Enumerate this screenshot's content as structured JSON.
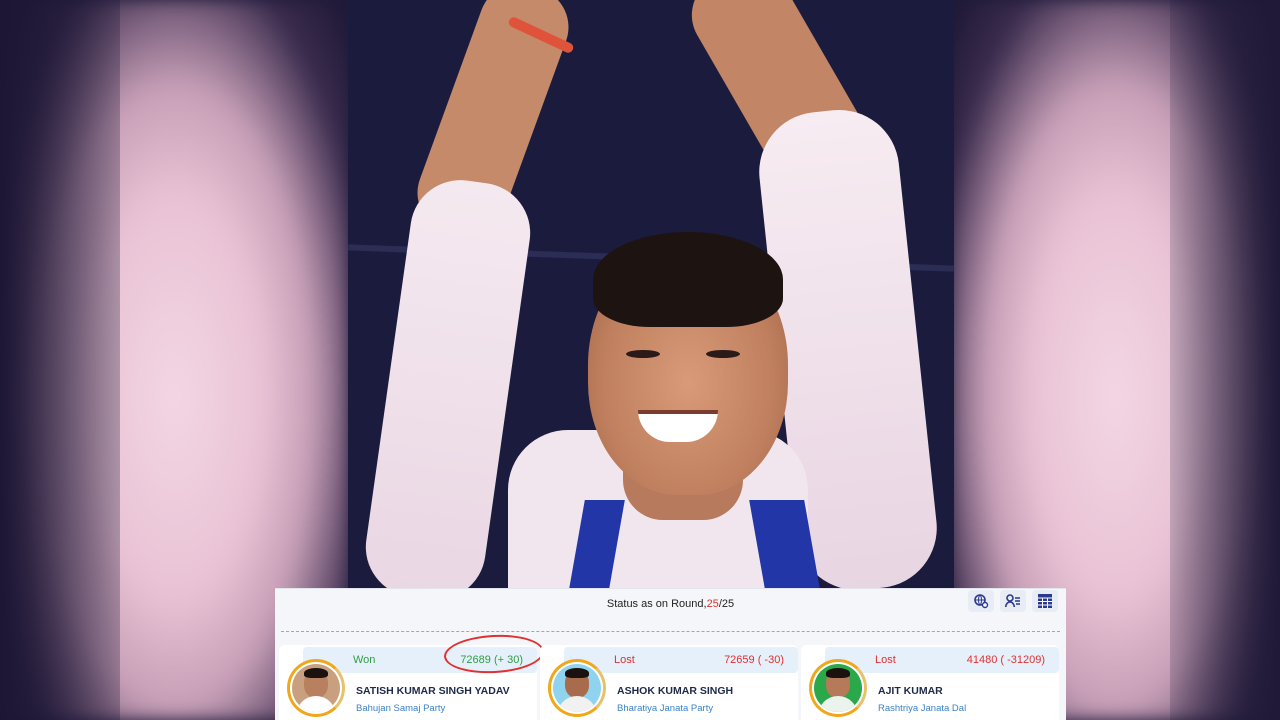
{
  "status": {
    "prefix": "Status as on Round, ",
    "current_round": "25",
    "separator": "/",
    "total_rounds": "25"
  },
  "toolbar": {
    "icons": [
      "globe-search-icon",
      "user-list-icon",
      "table-grid-icon"
    ]
  },
  "candidates": [
    {
      "result": "Won",
      "votes": "72689 (+ 30)",
      "name": "SATISH KUMAR SINGH YADAV",
      "party": "Bahujan Samaj Party",
      "avatar_bg": "#c9a07f"
    },
    {
      "result": "Lost",
      "votes": "72659 ( -30)",
      "name": "ASHOK KUMAR SINGH",
      "party": "Bharatiya Janata Party",
      "avatar_bg": "#8fd3ef"
    },
    {
      "result": "Lost",
      "votes": "41480 ( -31209)",
      "name": "AJIT KUMAR",
      "party": "Rashtriya Janata Dal",
      "avatar_bg": "#2aa84a"
    }
  ],
  "colors": {
    "won": "#2f9e44",
    "lost": "#e03131",
    "party_link": "#3b82c4",
    "current_round": "#e03131"
  }
}
